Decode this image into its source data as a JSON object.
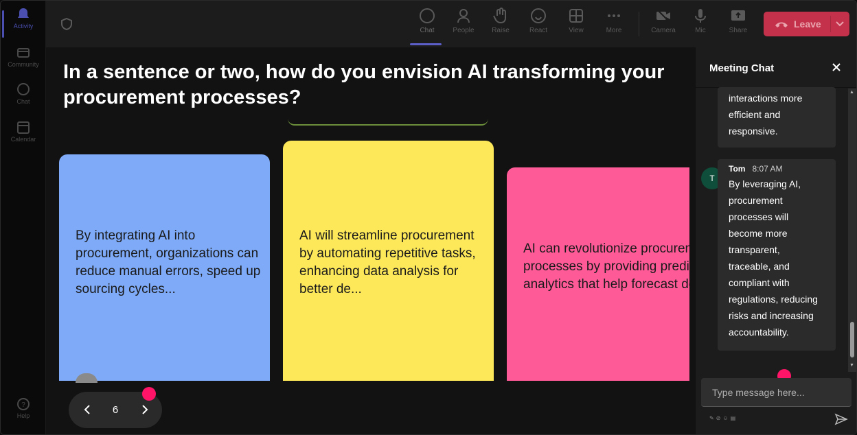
{
  "rail": {
    "items": [
      {
        "label": "Activity",
        "icon": "bell-icon"
      },
      {
        "label": "Community",
        "icon": "community-icon"
      },
      {
        "label": "Chat",
        "icon": "chat-icon"
      },
      {
        "label": "Calendar",
        "icon": "calendar-icon"
      },
      {
        "label": "Help",
        "icon": "help-icon"
      }
    ]
  },
  "toolbar": {
    "chat": "Chat",
    "people": "People",
    "raise": "Raise",
    "react": "React",
    "view": "View",
    "more": "More",
    "camera": "Camera",
    "mic": "Mic",
    "share": "Share",
    "leave": "Leave"
  },
  "main": {
    "question": "In a sentence or two, how do you envision AI transforming your procurement processes?",
    "cards": [
      {
        "text": "By integrating AI into procurement, organizations can reduce manual errors, speed up sourcing cycles...",
        "color": "#7eaaf7"
      },
      {
        "text": "AI will streamline procurement by automating repetitive tasks, enhancing data analysis for better de...",
        "color": "#fde85a"
      },
      {
        "text": "AI can revolutionize procurement processes by providing predictive analytics that help forecast dema...",
        "color": "#ff5a98"
      }
    ],
    "page_number": "6"
  },
  "chat": {
    "title": "Meeting Chat",
    "messages": [
      {
        "text": "interactions more efficient and responsive."
      },
      {
        "author": "Tom",
        "initial": "T",
        "time": "8:07 AM",
        "text": "By leveraging AI, procurement processes will become more transparent, traceable, and compliant with regulations, reducing risks and increasing accountability."
      }
    ],
    "input_placeholder": "Type message here..."
  },
  "colors": {
    "accent": "#5b5fc7",
    "leave": "#c4314b",
    "marker": "#ff1467"
  }
}
